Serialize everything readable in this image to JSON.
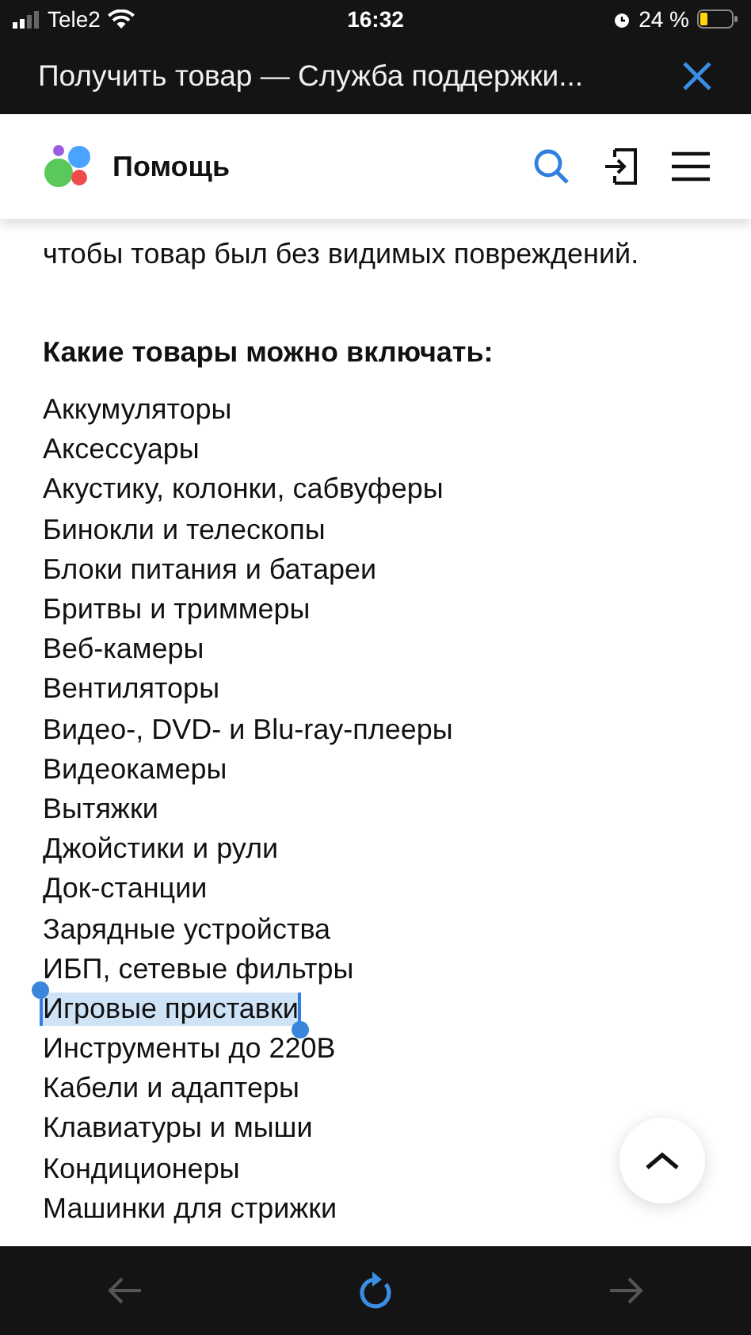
{
  "status_bar": {
    "carrier": "Tele2",
    "time": "16:32",
    "battery": "24 %"
  },
  "browser": {
    "title": "Получить товар — Служба поддержки..."
  },
  "site_header": {
    "title": "Помощь"
  },
  "article": {
    "paragraph_end": "чтобы товар был без видимых повреждений.",
    "heading": "Какие товары можно включать:",
    "items": [
      {
        "text": "Аккумуляторы",
        "selected": false
      },
      {
        "text": "Аксессуары",
        "selected": false
      },
      {
        "text": "Акустику, колонки, сабвуферы",
        "selected": false
      },
      {
        "text": "Бинокли и телескопы",
        "selected": false
      },
      {
        "text": "Блоки питания и батареи",
        "selected": false
      },
      {
        "text": "Бритвы и триммеры",
        "selected": false
      },
      {
        "text": "Веб-камеры",
        "selected": false
      },
      {
        "text": "Вентиляторы",
        "selected": false
      },
      {
        "text": "Видео-, DVD- и Blu-ray-плееры",
        "selected": false
      },
      {
        "text": "Видеокамеры",
        "selected": false
      },
      {
        "text": "Вытяжки",
        "selected": false
      },
      {
        "text": "Джойстики и рули",
        "selected": false
      },
      {
        "text": "Док-станции",
        "selected": false
      },
      {
        "text": "Зарядные устройства",
        "selected": false
      },
      {
        "text": "ИБП, сетевые фильтры",
        "selected": false
      },
      {
        "text": "Игровые приставки",
        "selected": true
      },
      {
        "text": "Инструменты до 220В",
        "selected": false
      },
      {
        "text": "Кабели и адаптеры",
        "selected": false
      },
      {
        "text": "Клавиатуры и мыши",
        "selected": false
      },
      {
        "text": "Кондиционеры",
        "selected": false
      },
      {
        "text": "Машинки для стрижки",
        "selected": false
      }
    ]
  }
}
